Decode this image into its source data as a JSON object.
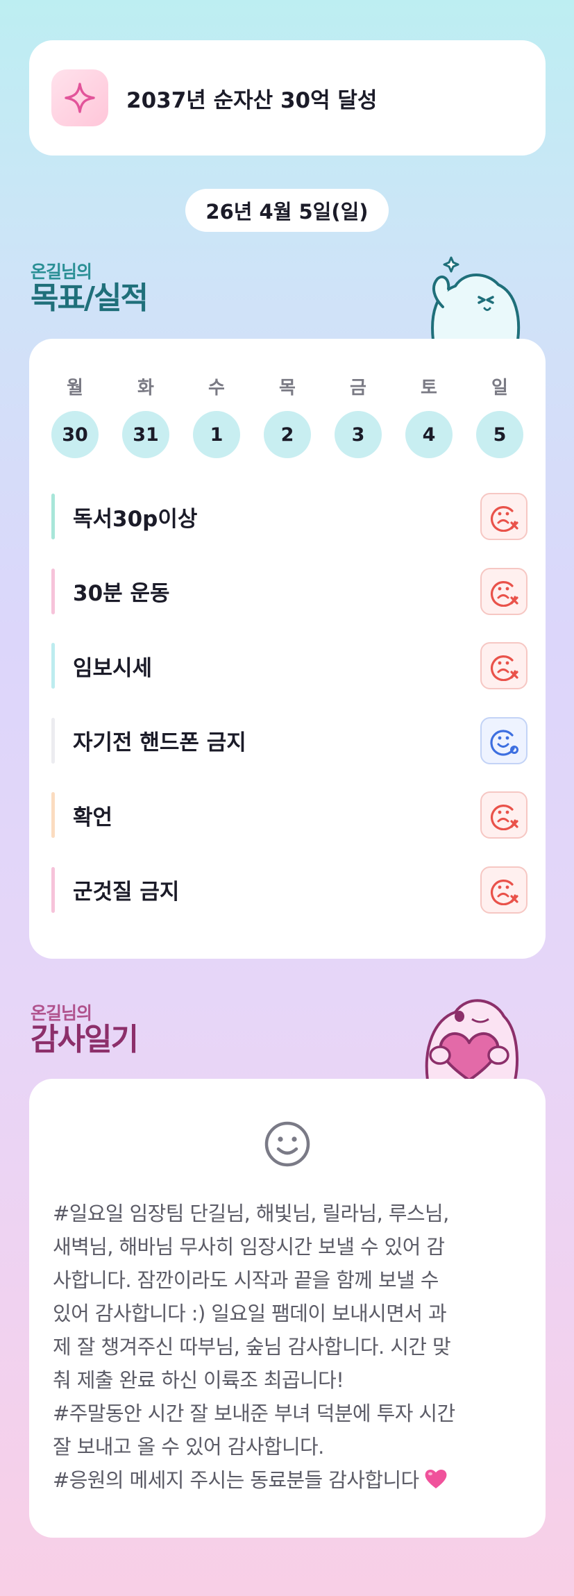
{
  "goal": {
    "text": "2037년 순자산 30억 달성",
    "icon": "sparkle-icon"
  },
  "date": "26년 4월 5일(일)",
  "goals_section": {
    "sub": "온길님의",
    "main": "목표/실적"
  },
  "week": [
    {
      "day": "월",
      "num": "30"
    },
    {
      "day": "화",
      "num": "31"
    },
    {
      "day": "수",
      "num": "1"
    },
    {
      "day": "목",
      "num": "2"
    },
    {
      "day": "금",
      "num": "3"
    },
    {
      "day": "토",
      "num": "4"
    },
    {
      "day": "일",
      "num": "5"
    }
  ],
  "habits": [
    {
      "label": "독서30p이상",
      "bar_color": "#a8e6d9",
      "status": "fail"
    },
    {
      "label": "30분 운동",
      "bar_color": "#f6c3da",
      "status": "fail"
    },
    {
      "label": "임보시세",
      "bar_color": "#bdecef",
      "status": "fail"
    },
    {
      "label": "자기전 핸드폰 금지",
      "bar_color": "#ececf0",
      "status": "done"
    },
    {
      "label": "확언",
      "bar_color": "#fbdcc0",
      "status": "fail"
    },
    {
      "label": "군것질 금지",
      "bar_color": "#f6c3da",
      "status": "fail"
    }
  ],
  "gratitude_section": {
    "sub": "온길님의",
    "main": "감사일기"
  },
  "gratitude": {
    "icon": "smile-icon",
    "text": "#일요일 임장팀 단길님, 해빛님, 릴라님, 루스님,\n새벽님, 해바님 무사히 임장시간 보낼 수 있어 감\n사합니다. 잠깐이라도 시작과 끝을 함께 보낼 수\n있어 감사합니다 :) 일요일 팸데이 보내시면서 과\n제 잘 챙겨주신 따부님, 숲님 감사합니다. 시간 맞\n춰 제출 완료 하신 이륙조 최곱니다!\n#주말동안 시간 잘 보내준 부녀 덕분에 투자 시간\n잘 보내고 올 수 있어 감사합니다.\n#응원의 메세지 주시는 동료분들 감사합니다"
  },
  "colors": {
    "fail": "#e9524a",
    "done": "#3d6fe0",
    "day_circle": "#c8eef1"
  }
}
